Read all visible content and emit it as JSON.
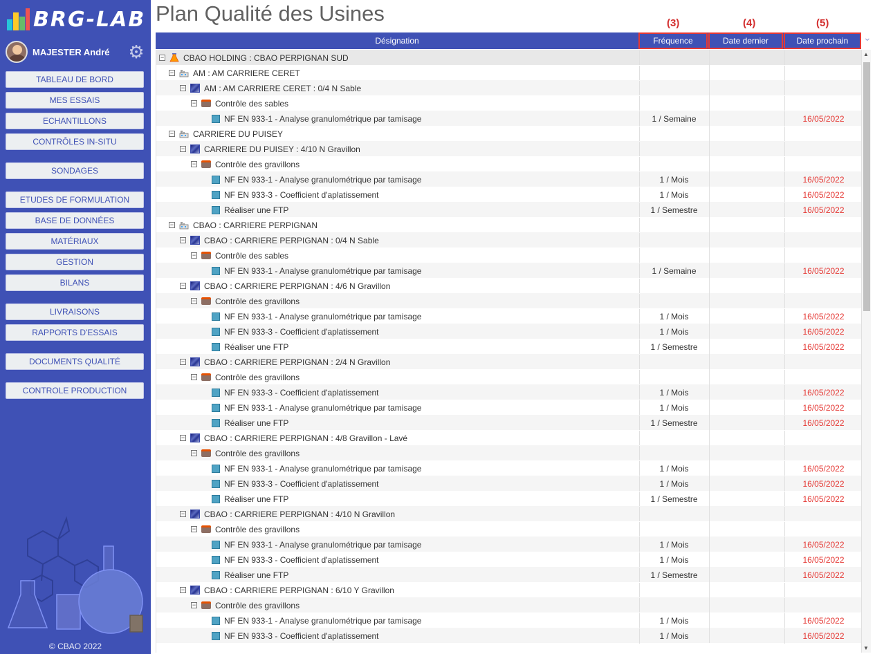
{
  "app": {
    "logo_text": "BRG-LAB",
    "user_name": "MAJESTER André",
    "copyright": "© CBAO 2022"
  },
  "sidebar": {
    "groups": [
      [
        "TABLEAU DE BORD",
        "MES ESSAIS",
        "ECHANTILLONS",
        "CONTRÔLES IN-SITU"
      ],
      [
        "SONDAGES"
      ],
      [
        "ETUDES DE FORMULATION",
        "BASE DE DONNÉES",
        "MATÉRIAUX",
        "GESTION",
        "BILANS"
      ],
      [
        "LIVRAISONS",
        "RAPPORTS D'ESSAIS"
      ],
      [
        "DOCUMENTS QUALITÉ"
      ],
      [
        "CONTROLE PRODUCTION"
      ]
    ]
  },
  "page": {
    "title": "Plan Qualité des Usines",
    "annotations": [
      "(3)",
      "(4)",
      "(5)"
    ]
  },
  "table": {
    "headers": {
      "designation": "Désignation",
      "frequency": "Fréquence",
      "last_date": "Date dernier",
      "next_date": "Date prochain"
    },
    "rows": [
      {
        "level": 0,
        "icon": "flask",
        "label": "CBAO HOLDING : CBAO PERPIGNAN SUD",
        "freq": "",
        "last": "",
        "next": ""
      },
      {
        "level": 1,
        "icon": "factory",
        "label": "AM : AM CARRIERE CERET",
        "freq": "",
        "last": "",
        "next": ""
      },
      {
        "level": 2,
        "icon": "material",
        "label": "AM : AM CARRIERE CERET : 0/4 N Sable",
        "freq": "",
        "last": "",
        "next": ""
      },
      {
        "level": 3,
        "icon": "case",
        "label": "Contrôle des sables",
        "freq": "",
        "last": "",
        "next": ""
      },
      {
        "level": 4,
        "icon": "test",
        "label": "NF EN 933-1 - Analyse granulométrique par tamisage",
        "freq": "1 / Semaine",
        "last": "",
        "next": "16/05/2022"
      },
      {
        "level": 1,
        "icon": "factory",
        "label": "CARRIERE DU PUISEY",
        "freq": "",
        "last": "",
        "next": ""
      },
      {
        "level": 2,
        "icon": "material",
        "label": "CARRIERE DU PUISEY : 4/10 N Gravillon",
        "freq": "",
        "last": "",
        "next": ""
      },
      {
        "level": 3,
        "icon": "case",
        "label": "Contrôle des gravillons",
        "freq": "",
        "last": "",
        "next": ""
      },
      {
        "level": 4,
        "icon": "test",
        "label": "NF EN 933-1 - Analyse granulométrique par tamisage",
        "freq": "1 / Mois",
        "last": "",
        "next": "16/05/2022"
      },
      {
        "level": 4,
        "icon": "test",
        "label": "NF EN 933-3 - Coefficient d'aplatissement",
        "freq": "1 / Mois",
        "last": "",
        "next": "16/05/2022"
      },
      {
        "level": 4,
        "icon": "test",
        "label": "Réaliser une FTP",
        "freq": "1 / Semestre",
        "last": "",
        "next": "16/05/2022"
      },
      {
        "level": 1,
        "icon": "factory",
        "label": "CBAO : CARRIERE PERPIGNAN",
        "freq": "",
        "last": "",
        "next": ""
      },
      {
        "level": 2,
        "icon": "material",
        "label": "CBAO : CARRIERE PERPIGNAN : 0/4 N Sable",
        "freq": "",
        "last": "",
        "next": ""
      },
      {
        "level": 3,
        "icon": "case",
        "label": "Contrôle des sables",
        "freq": "",
        "last": "",
        "next": ""
      },
      {
        "level": 4,
        "icon": "test",
        "label": "NF EN 933-1 - Analyse granulométrique par tamisage",
        "freq": "1 / Semaine",
        "last": "",
        "next": "16/05/2022"
      },
      {
        "level": 2,
        "icon": "material",
        "label": "CBAO : CARRIERE PERPIGNAN : 4/6 N Gravillon",
        "freq": "",
        "last": "",
        "next": ""
      },
      {
        "level": 3,
        "icon": "case",
        "label": "Contrôle des gravillons",
        "freq": "",
        "last": "",
        "next": ""
      },
      {
        "level": 4,
        "icon": "test",
        "label": "NF EN 933-1 - Analyse granulométrique par tamisage",
        "freq": "1 / Mois",
        "last": "",
        "next": "16/05/2022"
      },
      {
        "level": 4,
        "icon": "test",
        "label": "NF EN 933-3 - Coefficient d'aplatissement",
        "freq": "1 / Mois",
        "last": "",
        "next": "16/05/2022"
      },
      {
        "level": 4,
        "icon": "test",
        "label": "Réaliser une FTP",
        "freq": "1 / Semestre",
        "last": "",
        "next": "16/05/2022"
      },
      {
        "level": 2,
        "icon": "material",
        "label": "CBAO : CARRIERE PERPIGNAN : 2/4 N Gravillon",
        "freq": "",
        "last": "",
        "next": ""
      },
      {
        "level": 3,
        "icon": "case",
        "label": "Contrôle des gravillons",
        "freq": "",
        "last": "",
        "next": ""
      },
      {
        "level": 4,
        "icon": "test",
        "label": "NF EN 933-3 - Coefficient d'aplatissement",
        "freq": "1 / Mois",
        "last": "",
        "next": "16/05/2022"
      },
      {
        "level": 4,
        "icon": "test",
        "label": "NF EN 933-1 - Analyse granulométrique par tamisage",
        "freq": "1 / Mois",
        "last": "",
        "next": "16/05/2022"
      },
      {
        "level": 4,
        "icon": "test",
        "label": "Réaliser une FTP",
        "freq": "1 / Semestre",
        "last": "",
        "next": "16/05/2022"
      },
      {
        "level": 2,
        "icon": "material",
        "label": "CBAO : CARRIERE PERPIGNAN : 4/8 Gravillon - Lavé",
        "freq": "",
        "last": "",
        "next": ""
      },
      {
        "level": 3,
        "icon": "case",
        "label": "Contrôle des gravillons",
        "freq": "",
        "last": "",
        "next": ""
      },
      {
        "level": 4,
        "icon": "test",
        "label": "NF EN 933-1 - Analyse granulométrique par tamisage",
        "freq": "1 / Mois",
        "last": "",
        "next": "16/05/2022"
      },
      {
        "level": 4,
        "icon": "test",
        "label": "NF EN 933-3 - Coefficient d'aplatissement",
        "freq": "1 / Mois",
        "last": "",
        "next": "16/05/2022"
      },
      {
        "level": 4,
        "icon": "test",
        "label": "Réaliser une FTP",
        "freq": "1 / Semestre",
        "last": "",
        "next": "16/05/2022"
      },
      {
        "level": 2,
        "icon": "material",
        "label": "CBAO : CARRIERE PERPIGNAN : 4/10 N Gravillon",
        "freq": "",
        "last": "",
        "next": ""
      },
      {
        "level": 3,
        "icon": "case",
        "label": "Contrôle des gravillons",
        "freq": "",
        "last": "",
        "next": ""
      },
      {
        "level": 4,
        "icon": "test",
        "label": "NF EN 933-1 - Analyse granulométrique par tamisage",
        "freq": "1 / Mois",
        "last": "",
        "next": "16/05/2022"
      },
      {
        "level": 4,
        "icon": "test",
        "label": "NF EN 933-3 - Coefficient d'aplatissement",
        "freq": "1 / Mois",
        "last": "",
        "next": "16/05/2022"
      },
      {
        "level": 4,
        "icon": "test",
        "label": "Réaliser une FTP",
        "freq": "1 / Semestre",
        "last": "",
        "next": "16/05/2022"
      },
      {
        "level": 2,
        "icon": "material",
        "label": "CBAO : CARRIERE PERPIGNAN : 6/10 Y Gravillon",
        "freq": "",
        "last": "",
        "next": ""
      },
      {
        "level": 3,
        "icon": "case",
        "label": "Contrôle des gravillons",
        "freq": "",
        "last": "",
        "next": ""
      },
      {
        "level": 4,
        "icon": "test",
        "label": "NF EN 933-1 - Analyse granulométrique par tamisage",
        "freq": "1 / Mois",
        "last": "",
        "next": "16/05/2022"
      },
      {
        "level": 4,
        "icon": "test",
        "label": "NF EN 933-3 - Coefficient d'aplatissement",
        "freq": "1 / Mois",
        "last": "",
        "next": "16/05/2022"
      }
    ]
  },
  "colors": {
    "sidebar_bg": "#3f51b5",
    "header_bg": "#3f51b5",
    "accent_red": "#e53935",
    "annotation_red": "#d32f2f"
  }
}
